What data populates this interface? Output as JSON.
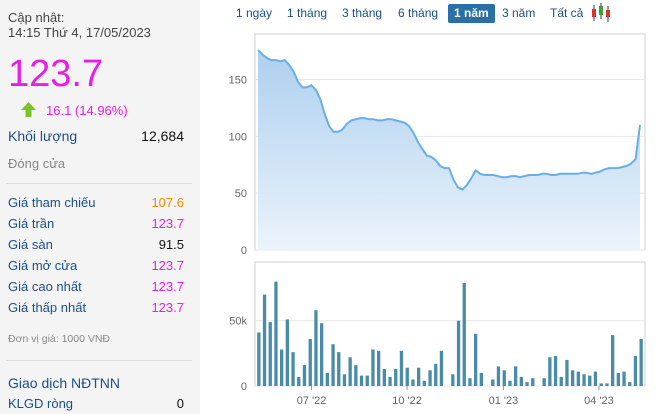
{
  "header": {
    "update_label": "Cập nhật:",
    "update_time": "14:15 Thứ 4, 17/05/2023"
  },
  "price": {
    "value": "123.7",
    "change": "16.1 (14.96%)",
    "arrow_icon": "up-arrow-icon",
    "color": "#e91ee6"
  },
  "volume": {
    "label": "Khối lượng",
    "value": "12,684"
  },
  "closing": {
    "label": "Đóng cửa"
  },
  "stats": [
    {
      "label": "Giá tham chiếu",
      "value": "107.6",
      "color": "#ef8a00"
    },
    {
      "label": "Giá trần",
      "value": "123.7",
      "color": "#e91ee6"
    },
    {
      "label": "Giá sàn",
      "value": "91.5",
      "color": "#111111"
    },
    {
      "label": "Giá mở cửa",
      "value": "123.7",
      "color": "#e91ee6"
    },
    {
      "label": "Giá cao nhất",
      "value": "123.7",
      "color": "#e91ee6"
    },
    {
      "label": "Giá thấp nhất",
      "value": "123.7",
      "color": "#e91ee6"
    }
  ],
  "unit_note": "Đơn vị giá: 1000 VNĐ",
  "foreign": {
    "title": "Giao dịch NĐTNN",
    "net_label": "KLGD ròng",
    "net_value": "0"
  },
  "toolbar": {
    "tabs": [
      "1 ngày",
      "1 tháng",
      "3 tháng",
      "6 tháng",
      "1 năm",
      "3 năm",
      "Tất cả"
    ],
    "active_tab": "1 năm",
    "chart_type_icon": "candlestick-icon"
  },
  "chart_data": [
    {
      "type": "area",
      "x_label": "",
      "y_label": "",
      "ylim": [
        0,
        190
      ],
      "y_ticks": [
        "0",
        "50",
        "100",
        "150"
      ],
      "grid": true,
      "values": [
        176,
        172,
        169,
        167,
        167,
        166,
        167,
        163,
        157,
        148,
        143,
        143,
        145,
        141,
        133,
        120,
        109,
        104,
        104,
        106,
        111,
        114,
        115,
        116,
        116,
        115,
        115,
        114,
        114,
        115,
        115,
        114,
        113,
        112,
        109,
        103,
        95,
        89,
        83,
        82,
        79,
        74,
        72,
        72,
        62,
        55,
        53,
        57,
        63,
        70,
        67,
        66,
        66,
        66,
        65,
        64,
        64,
        65,
        65,
        64,
        65,
        66,
        66,
        66,
        67,
        67,
        66,
        66,
        67,
        67,
        67,
        67,
        67,
        68,
        68,
        67,
        68,
        69,
        71,
        72,
        72,
        72,
        73,
        74,
        76,
        80,
        110
      ]
    },
    {
      "type": "bar",
      "y_label": "",
      "ylim": [
        0,
        95000
      ],
      "y_ticks": [
        "0",
        "50k"
      ],
      "x_ticks": [
        "07 '22",
        "10 '22",
        "01 '23",
        "04 '23"
      ],
      "grid": true,
      "values": [
        41000,
        70000,
        49000,
        80000,
        28000,
        51000,
        26000,
        7000,
        16000,
        36000,
        58000,
        48000,
        10000,
        32000,
        26000,
        9000,
        22000,
        16000,
        8000,
        8000,
        28000,
        27000,
        13000,
        7000,
        13000,
        27000,
        14000,
        5000,
        14000,
        4000,
        12000,
        17000,
        27000,
        0,
        9000,
        50000,
        79000,
        6000,
        40000,
        10000,
        0,
        5000,
        15000,
        12000,
        4000,
        15000,
        7000,
        3000,
        6000,
        0,
        6000,
        22000,
        23000,
        7000,
        20000,
        12000,
        11000,
        9000,
        8000,
        11000,
        2000,
        2000,
        39000,
        10000,
        11000,
        3000,
        23000,
        36000
      ]
    }
  ]
}
